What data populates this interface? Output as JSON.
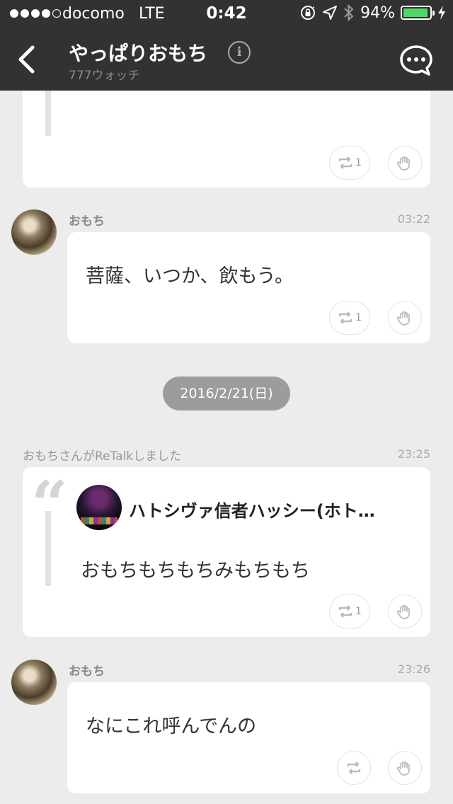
{
  "status_bar": {
    "carrier": "docomo",
    "network": "LTE",
    "time": "0:42",
    "battery_text": "94%",
    "battery_level": 0.94,
    "signal_bars": 4,
    "signal_total": 5
  },
  "header": {
    "title": "やっぱりおもち",
    "subtitle": "777ウォッチ",
    "icons": [
      "back-chevron-icon",
      "info-icon",
      "chat-bubble-icon"
    ]
  },
  "feed": {
    "post_0": {
      "text": "",
      "retalk_count": "1"
    },
    "post_1": {
      "author": "おもち",
      "time": "03:22",
      "text": "菩薩、いつか、飲もう。",
      "retalk_count": "1"
    },
    "date_separator": "2016/2/21(日)",
    "retalk_notice": {
      "text": "おもちさんがReTalkしました",
      "time": "23:25"
    },
    "quoted": {
      "author": "ハトシヴァ信者ハッシー(ホト…",
      "text": "おもちもちもちみもちもち",
      "retalk_count": "1",
      "quote_mark": "“"
    },
    "post_2": {
      "author": "おもち",
      "time": "23:26",
      "text": "なにこれ呼んでんの"
    }
  },
  "colors": {
    "nav_background": "#323232",
    "page_background": "#ececec",
    "battery_fill": "#4cd964",
    "date_pill": "#9c9c9c"
  }
}
